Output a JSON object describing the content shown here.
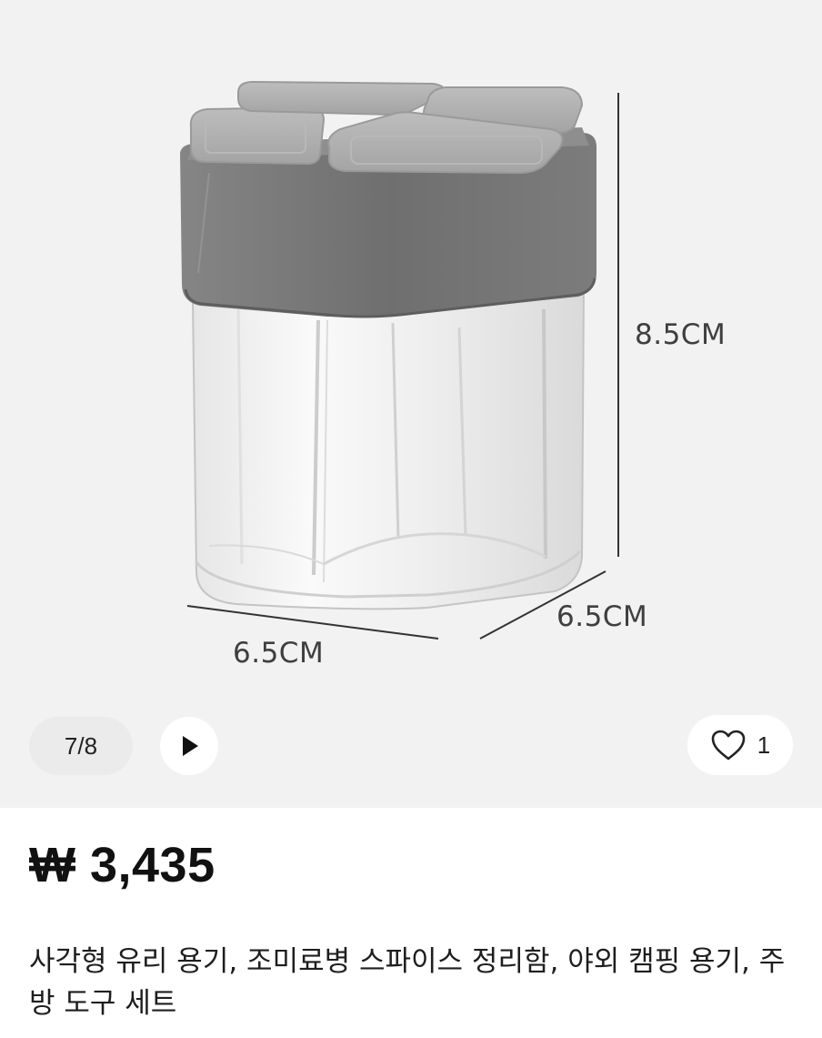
{
  "gallery": {
    "counter": "7/8",
    "dimensions": {
      "height": "8.5CM",
      "depth": "6.5CM",
      "width": "6.5CM"
    },
    "play_icon": "play-icon",
    "like": {
      "icon": "heart-outline-icon",
      "count": "1"
    }
  },
  "product": {
    "price": "₩ 3,435",
    "title": "사각형 유리 용기, 조미료병 스파이스 정리함, 야외 캠핑 용기, 주방 도구 세트"
  },
  "colors": {
    "gallery_bg": "#f2f2f2",
    "lid_gray": "#7a7a7a",
    "text_dark": "#111111"
  }
}
